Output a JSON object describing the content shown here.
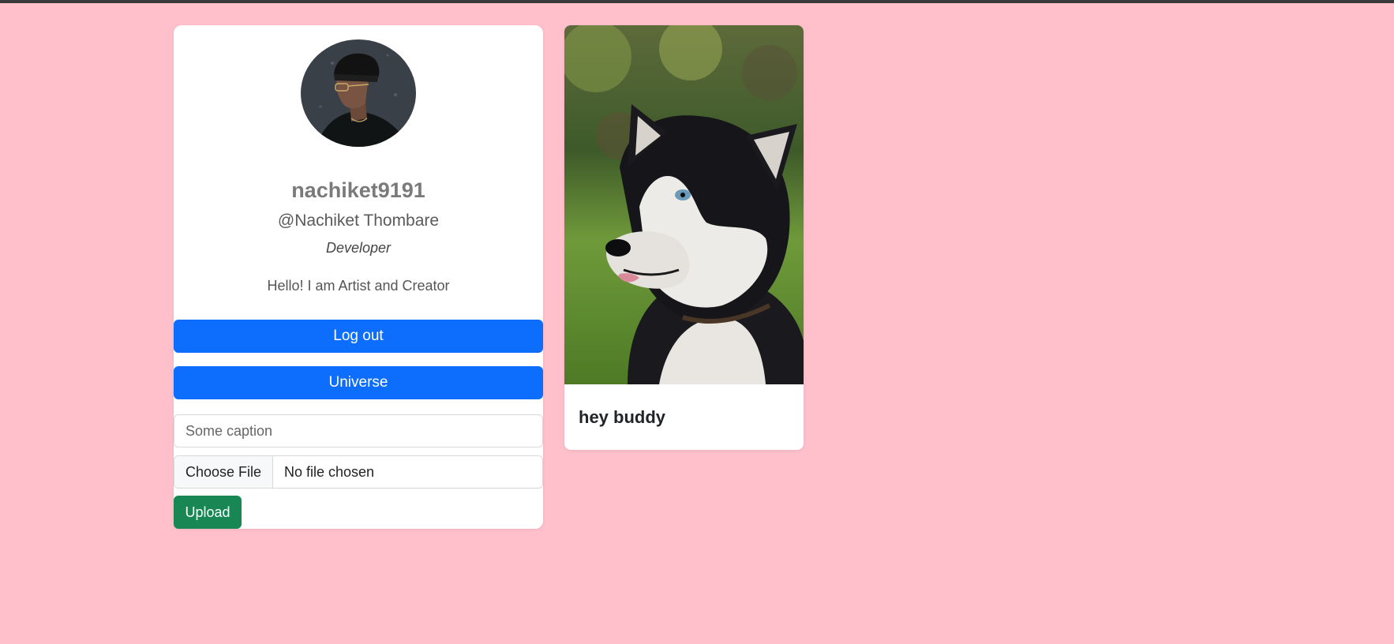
{
  "profile": {
    "username": "nachiket9191",
    "handle": "@Nachiket Thombare",
    "role": "Developer",
    "bio": "Hello! I am Artist and Creator",
    "avatar_icon": "person-avatar-photo"
  },
  "actions": {
    "logout_label": "Log out",
    "universe_label": "Universe",
    "upload_label": "Upload"
  },
  "upload_form": {
    "caption_placeholder": "Some caption",
    "choose_file_label": "Choose File",
    "file_status": "No file chosen"
  },
  "posts": [
    {
      "image_icon": "husky-dog-photo",
      "caption": "hey buddy"
    }
  ],
  "colors": {
    "background": "#ffc0cb",
    "primary": "#0d6efd",
    "success": "#198754"
  }
}
